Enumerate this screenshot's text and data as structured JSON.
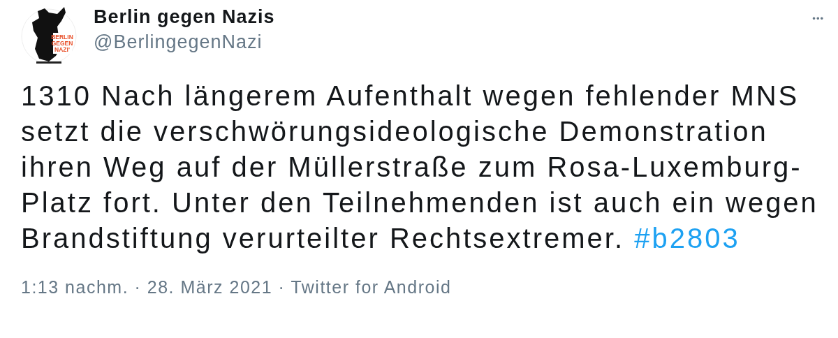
{
  "author": {
    "name": "Berlin gegen Nazis",
    "handle": "@BerlingegenNazi",
    "avatar_text": [
      "BERLIN",
      "GEGEN",
      "NAZI'"
    ]
  },
  "more_menu": "•••",
  "tweet": {
    "text": "1310 Nach längerem Aufenthalt wegen fehlender MNS setzt die verschwörungsideologische Demonstration ihren Weg auf der Müllerstraße zum Rosa-Luxemburg-Platz fort. Unter den Teilnehmenden ist auch ein wegen Brandstiftung verurteilter Rechtsextremer.",
    "hashtag": "#b2803"
  },
  "meta": {
    "time": "1:13 nachm.",
    "separator": "·",
    "date": "28. März 2021",
    "source": "Twitter for Android"
  }
}
